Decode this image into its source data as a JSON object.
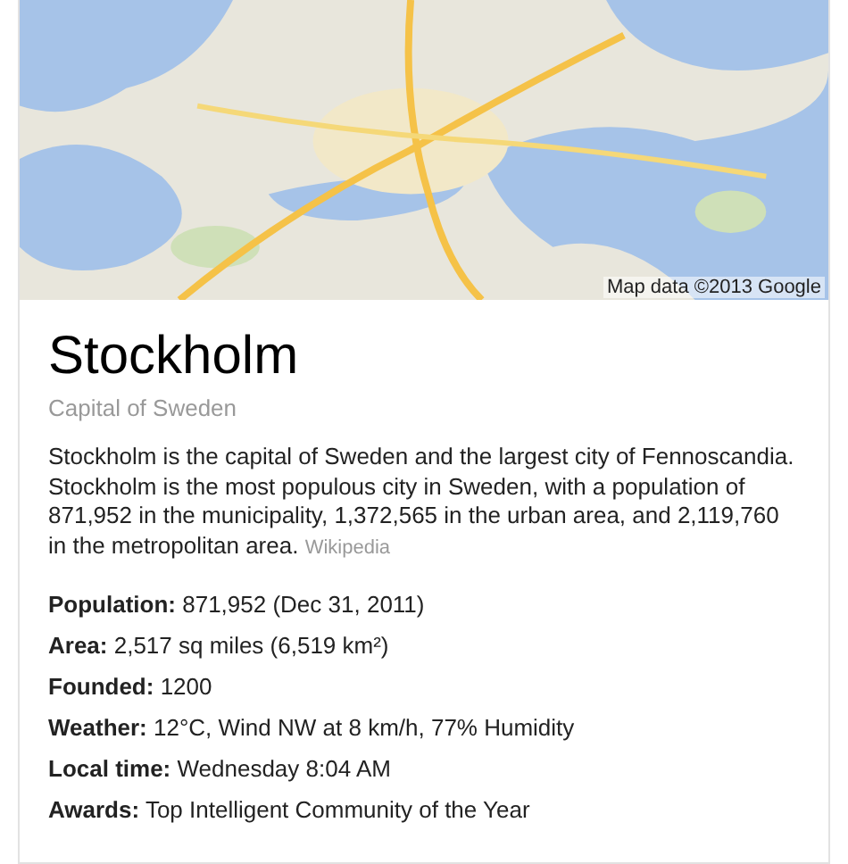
{
  "map": {
    "kind": "picture",
    "attribution": "Map data ©2013 Google"
  },
  "title": "Stockholm",
  "subtitle": "Capital of Sweden",
  "description": {
    "text": "Stockholm is the capital of Sweden and the largest city of Fennoscandia. Stockholm is the most populous city in Sweden, with a population of 871,952 in the municipality, 1,372,565 in the urban area, and 2,119,760 in the metropolitan area.",
    "source": "Wikipedia"
  },
  "facts": [
    {
      "label": "Population:",
      "value": "871,952 (Dec 31, 2011)"
    },
    {
      "label": "Area:",
      "value": "2,517 sq miles (6,519 km²)"
    },
    {
      "label": "Founded:",
      "value": "1200"
    },
    {
      "label": "Weather:",
      "value": "12°C, Wind NW at 8 km/h, 77% Humidity"
    },
    {
      "label": "Local time:",
      "value": "Wednesday 8:04 AM"
    },
    {
      "label": "Awards:",
      "value": "Top Intelligent Community of the Year"
    }
  ]
}
